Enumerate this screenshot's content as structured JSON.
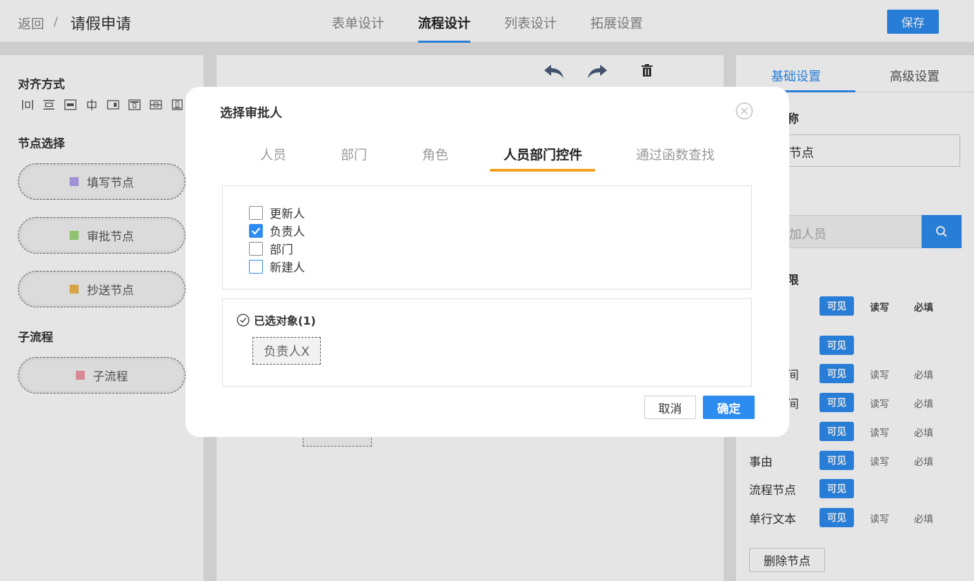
{
  "header": {
    "back_label": "返回",
    "separator": "/",
    "title": "请假申请",
    "tabs": [
      {
        "label": "表单设计"
      },
      {
        "label": "流程设计"
      },
      {
        "label": "列表设计"
      },
      {
        "label": "拓展设置"
      }
    ],
    "active_tab": "流程设计",
    "save_label": "保存"
  },
  "left_panel": {
    "align_title": "对齐方式",
    "align_icons": [
      "align-left-icon",
      "align-center-horizontal-icon",
      "align-right-icon",
      "align-vertical-center-icon",
      "align-distribute-icon",
      "align-top-icon",
      "align-middle-icon",
      "align-bottom-icon"
    ],
    "node_title": "节点选择",
    "nodes": [
      {
        "label": "填写节点",
        "color": "#b3a3f0"
      },
      {
        "label": "审批节点",
        "color": "#9fd87c"
      },
      {
        "label": "抄送节点",
        "color": "#f0b850"
      }
    ],
    "subflow_title": "子流程",
    "subflow": {
      "label": "子流程",
      "color": "#f09aa8"
    }
  },
  "canvas": {
    "tools": [
      {
        "icon": "undo-icon"
      },
      {
        "icon": "redo-icon"
      },
      {
        "icon": "trash-icon"
      }
    ]
  },
  "right_panel": {
    "tabs": [
      "基础设置",
      "高级设置"
    ],
    "active_tab": "基础设置",
    "name_label_fragment": "称",
    "name_value_fragment": "节点",
    "search_placeholder_fragment": "加人员",
    "perm_label_fragment": "限",
    "perm_visible": "可见",
    "perm_readwrite": "读写",
    "perm_required": "必填",
    "rows": [
      {
        "label": "",
        "has_rw": true,
        "bold": true
      },
      {
        "label": "",
        "has_rw": false
      },
      {
        "label": "间",
        "has_rw": true
      },
      {
        "label": "间",
        "has_rw": true
      },
      {
        "label": "",
        "has_rw": true
      },
      {
        "label": "事由",
        "has_rw": true
      },
      {
        "label": "流程节点",
        "has_rw": false
      },
      {
        "label": "单行文本",
        "has_rw": true
      }
    ],
    "delete_node_label": "删除节点"
  },
  "dialog": {
    "title": "选择审批人",
    "tabs": [
      "人员",
      "部门",
      "角色",
      "人员部门控件",
      "通过函数查找"
    ],
    "active_tab": "人员部门控件",
    "options": [
      {
        "label": "更新人",
        "checked": false
      },
      {
        "label": "负责人",
        "checked": true
      },
      {
        "label": "部门",
        "checked": false
      },
      {
        "label": "新建人",
        "checked": false
      }
    ],
    "selected_title": "已选对象(1)",
    "selected_chip": "负责人X",
    "cancel_label": "取消",
    "ok_label": "确定"
  }
}
